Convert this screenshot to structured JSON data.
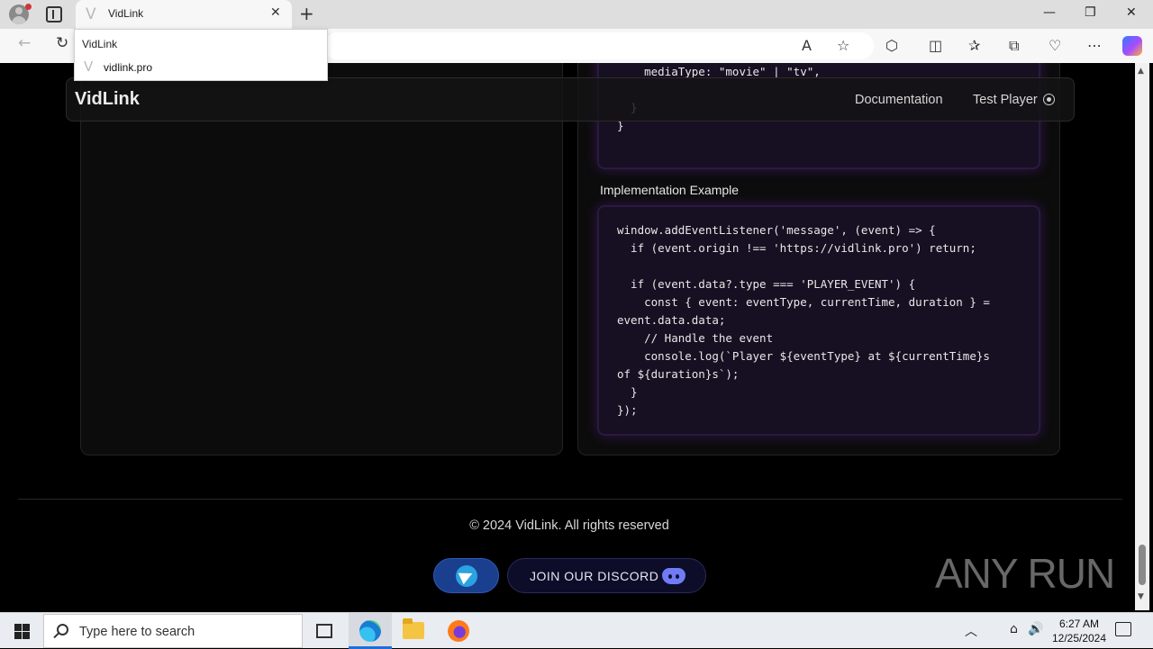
{
  "browser": {
    "tab_title": "VidLink",
    "tab_favicon": "V",
    "tab_close": "✕",
    "new_tab": "+",
    "window": {
      "minimize": "—",
      "maximize": "❐",
      "close": "✕"
    },
    "nav": {
      "back": "←",
      "refresh": "↻"
    },
    "toolbar_icons": {
      "read_aloud": "A",
      "favorite": "☆",
      "extensions": "⬡",
      "split": "◫",
      "favorites": "✰",
      "collections": "⧉",
      "performance": "♡",
      "more": "⋯"
    },
    "hover_card": {
      "title": "VidLink",
      "favicon": "V",
      "url": "vidlink.pro"
    }
  },
  "page": {
    "navbar": {
      "brand": "VidLink",
      "links": [
        "Documentation",
        "Test Player"
      ]
    },
    "code_top": "    mediaType: \"movie\" | \"tv\",\n\n  }\n}",
    "implementation_title": "Implementation Example",
    "code_bottom": "window.addEventListener('message', (event) => {\n  if (event.origin !== 'https://vidlink.pro') return;\n\n  if (event.data?.type === 'PLAYER_EVENT') {\n    const { event: eventType, currentTime, duration } =\nevent.data.data;\n    // Handle the event\n    console.log(`Player ${eventType} at ${currentTime}s\nof ${duration}s`);\n  }\n});",
    "footer": {
      "copyright": "© 2024 VidLink. All rights reserved",
      "discord_label": "JOIN OUR DISCORD"
    },
    "watermark": "ANY RUN"
  },
  "scrollbar": {
    "up": "▲",
    "down": "▼"
  },
  "taskbar": {
    "search_placeholder": "Type here to search",
    "tray": {
      "chevron": "︿",
      "network": "⌂",
      "volume": "🔊"
    },
    "time": "6:27 AM",
    "date": "12/25/2024"
  },
  "colors": {
    "page_bg": "#000000",
    "code_bg": "#170f22",
    "telegram": "#2aa3e0",
    "discord": "#6f7cf5"
  }
}
